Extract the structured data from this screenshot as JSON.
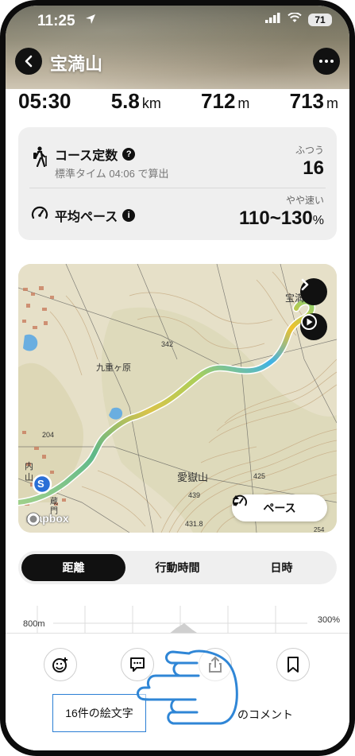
{
  "status_bar": {
    "time": "11:25",
    "battery": "71"
  },
  "header": {
    "title": "宝満山"
  },
  "stats": [
    {
      "value": "05:30",
      "unit": ""
    },
    {
      "value": "5.8",
      "unit": "km"
    },
    {
      "value": "712",
      "unit": "m"
    },
    {
      "value": "713",
      "unit": "m"
    }
  ],
  "course_card": {
    "course_constant_label": "コース定数",
    "standard_time_text": "標準タイム 04:06 で算出",
    "difficulty": "ふつう",
    "course_constant_value": "16",
    "pace_label": "平均ペース",
    "pace_rating": "やや速い",
    "pace_value": "110~130",
    "pace_unit": "%"
  },
  "map": {
    "labels": {
      "peak": "宝満",
      "kuju": "九重ヶ原",
      "atago": "愛嶽山",
      "h342": "342",
      "h425": "425",
      "h439": "439",
      "h431": "431.8",
      "h254": "254",
      "h204": "204",
      "uchi": "内",
      "yama": "山",
      "kura": "蔵",
      "mon": "門"
    },
    "logo": "mapbox",
    "pace_button": "ペース",
    "start_marker": "S"
  },
  "segmented": {
    "items": [
      "距離",
      "行動時間",
      "日時"
    ],
    "active": 0
  },
  "elevation": {
    "left_label": "800m",
    "right_label": "300%"
  },
  "bottom": {
    "emoji_reactions": "16件の絵文字",
    "comments": "のコメント"
  },
  "colors": {
    "accent": "#111111",
    "route_start": "#9ad27a",
    "route_mid": "#e3c24a",
    "route_cyan": "#3ab4e8"
  }
}
